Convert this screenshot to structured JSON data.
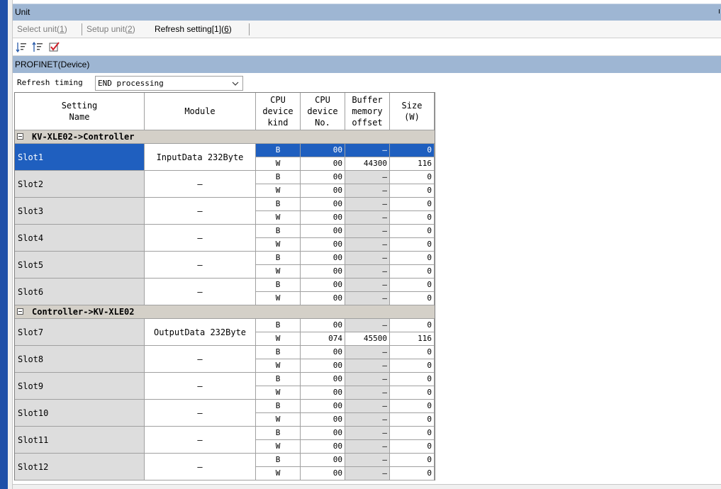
{
  "window": {
    "title": "Unit",
    "pin_glyph": "ı"
  },
  "tabs": [
    {
      "label": "Select unit",
      "key": "1",
      "active": false
    },
    {
      "label": "Setup unit",
      "key": "2",
      "active": false
    },
    {
      "label": "Refresh setting[1]",
      "key": "6",
      "active": true
    }
  ],
  "toolbar": {
    "icons": [
      "sort-ascending-icon",
      "sort-descending-icon",
      "check-icon"
    ]
  },
  "section": {
    "title": "PROFINET(Device)"
  },
  "refresh": {
    "label": "Refresh timing",
    "value": "END processing"
  },
  "table": {
    "headers": {
      "setting_name": "Setting\nName",
      "module": "Module",
      "cpu_kind": "CPU\ndevice\nkind",
      "cpu_no": "CPU\ndevice\nNo.",
      "offset": "Buffer\nmemory\noffset",
      "size": "Size\n(W)"
    },
    "groups": [
      {
        "label": "KV-XLE02->Controller",
        "slots": [
          {
            "name": "Slot1",
            "module": "InputData 232Byte",
            "rows": [
              {
                "kind": "B",
                "no": "00",
                "offset": "–",
                "size": "0"
              },
              {
                "kind": "W",
                "no": "00",
                "offset": "44300",
                "size": "116"
              }
            ]
          },
          {
            "name": "Slot2",
            "module": "–",
            "rows": [
              {
                "kind": "B",
                "no": "00",
                "offset": "–",
                "size": "0"
              },
              {
                "kind": "W",
                "no": "00",
                "offset": "–",
                "size": "0"
              }
            ]
          },
          {
            "name": "Slot3",
            "module": "–",
            "rows": [
              {
                "kind": "B",
                "no": "00",
                "offset": "–",
                "size": "0"
              },
              {
                "kind": "W",
                "no": "00",
                "offset": "–",
                "size": "0"
              }
            ]
          },
          {
            "name": "Slot4",
            "module": "–",
            "rows": [
              {
                "kind": "B",
                "no": "00",
                "offset": "–",
                "size": "0"
              },
              {
                "kind": "W",
                "no": "00",
                "offset": "–",
                "size": "0"
              }
            ]
          },
          {
            "name": "Slot5",
            "module": "–",
            "rows": [
              {
                "kind": "B",
                "no": "00",
                "offset": "–",
                "size": "0"
              },
              {
                "kind": "W",
                "no": "00",
                "offset": "–",
                "size": "0"
              }
            ]
          },
          {
            "name": "Slot6",
            "module": "–",
            "rows": [
              {
                "kind": "B",
                "no": "00",
                "offset": "–",
                "size": "0"
              },
              {
                "kind": "W",
                "no": "00",
                "offset": "–",
                "size": "0"
              }
            ]
          }
        ]
      },
      {
        "label": "Controller->KV-XLE02",
        "slots": [
          {
            "name": "Slot7",
            "module": "OutputData 232Byte",
            "rows": [
              {
                "kind": "B",
                "no": "00",
                "offset": "–",
                "size": "0"
              },
              {
                "kind": "W",
                "no": "074",
                "offset": "45500",
                "size": "116"
              }
            ]
          },
          {
            "name": "Slot8",
            "module": "–",
            "rows": [
              {
                "kind": "B",
                "no": "00",
                "offset": "–",
                "size": "0"
              },
              {
                "kind": "W",
                "no": "00",
                "offset": "–",
                "size": "0"
              }
            ]
          },
          {
            "name": "Slot9",
            "module": "–",
            "rows": [
              {
                "kind": "B",
                "no": "00",
                "offset": "–",
                "size": "0"
              },
              {
                "kind": "W",
                "no": "00",
                "offset": "–",
                "size": "0"
              }
            ]
          },
          {
            "name": "Slot10",
            "module": "–",
            "rows": [
              {
                "kind": "B",
                "no": "00",
                "offset": "–",
                "size": "0"
              },
              {
                "kind": "W",
                "no": "00",
                "offset": "–",
                "size": "0"
              }
            ]
          },
          {
            "name": "Slot11",
            "module": "–",
            "rows": [
              {
                "kind": "B",
                "no": "00",
                "offset": "–",
                "size": "0"
              },
              {
                "kind": "W",
                "no": "00",
                "offset": "–",
                "size": "0"
              }
            ]
          },
          {
            "name": "Slot12",
            "module": "–",
            "rows": [
              {
                "kind": "B",
                "no": "00",
                "offset": "–",
                "size": "0"
              },
              {
                "kind": "W",
                "no": "00",
                "offset": "–",
                "size": "0"
              }
            ]
          }
        ]
      }
    ]
  },
  "colors": {
    "selection": "#1f5fbf",
    "titlebar": "#9eb6d3",
    "left_strip": "#1f4fa8"
  }
}
